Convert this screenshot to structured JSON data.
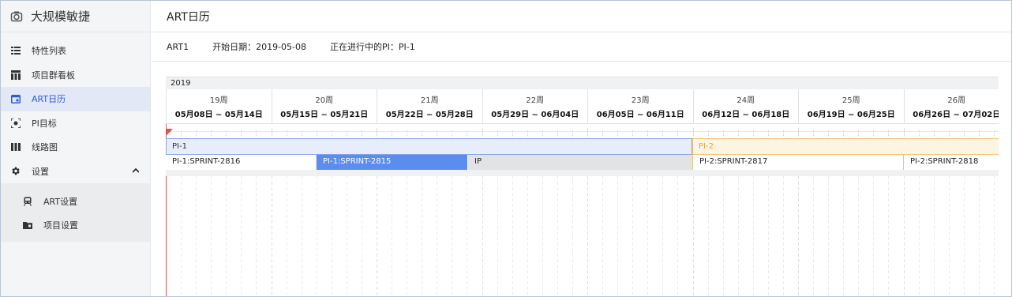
{
  "brand": {
    "name": "大规模敏捷",
    "icon": "camera-icon"
  },
  "sidebar": {
    "items": [
      {
        "label": "特性列表",
        "icon": "list-icon"
      },
      {
        "label": "项目群看板",
        "icon": "board-icon"
      },
      {
        "label": "ART日历",
        "icon": "calendar-icon",
        "active": true
      },
      {
        "label": "PI目标",
        "icon": "target-icon"
      },
      {
        "label": "线路图",
        "icon": "roadmap-icon"
      },
      {
        "label": "设置",
        "icon": "gear-icon",
        "expanded": true
      }
    ],
    "settings_children": [
      {
        "label": "ART设置",
        "icon": "train-icon"
      },
      {
        "label": "项目设置",
        "icon": "folder-icon"
      }
    ]
  },
  "header": {
    "title": "ART日历"
  },
  "info": {
    "art_name": "ART1",
    "start_date": "开始日期：2019-05-08",
    "current_pi": "正在进行中的PI：PI-1"
  },
  "calendar": {
    "year": "2019",
    "weeks": [
      {
        "number": "19周",
        "range": "05月08日 ~ 05月14日"
      },
      {
        "number": "20周",
        "range": "05月15日 ~ 05月21日"
      },
      {
        "number": "21周",
        "range": "05月22日 ~ 05月28日"
      },
      {
        "number": "22周",
        "range": "05月29日 ~ 06月04日"
      },
      {
        "number": "23周",
        "range": "06月05日 ~ 06月11日"
      },
      {
        "number": "24周",
        "range": "06月12日 ~ 06月18日"
      },
      {
        "number": "25周",
        "range": "06月19日 ~ 06月25日"
      },
      {
        "number": "26周",
        "range": "06月26日 ~ 07月02日"
      }
    ],
    "pis": [
      {
        "name": "PI-1",
        "color": "#8aa4e8"
      },
      {
        "name": "PI-2",
        "color": "#f2c36b"
      }
    ],
    "sprints": [
      {
        "name": "PI-1:SPRINT-2816"
      },
      {
        "name": "PI-1:SPRINT-2815",
        "color": "#5b8def"
      },
      {
        "name": "IP"
      },
      {
        "name": "PI-2:SPRINT-2817"
      },
      {
        "name": "PI-2:SPRINT-2818"
      }
    ],
    "today_color": "#d9534f"
  }
}
